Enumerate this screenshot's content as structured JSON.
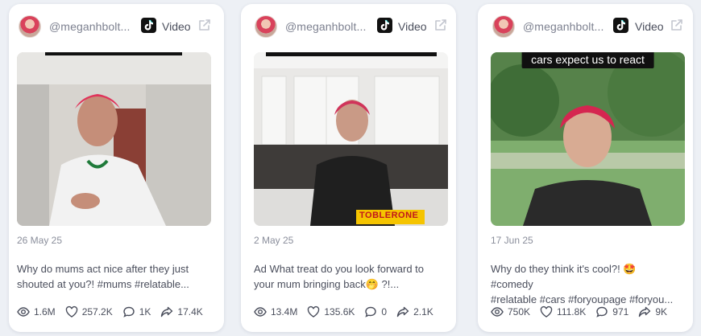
{
  "cards": [
    {
      "username": "@meganhbolt...",
      "source": "Video",
      "date": "26 May 25",
      "description_line1": "Why do mums act nice after they just",
      "description_line2": "shouted at you?! #mums #relatable...",
      "views": "1.6M",
      "likes": "257.2K",
      "comments": "1K",
      "shares": "17.4K"
    },
    {
      "username": "@meganhbolt...",
      "source": "Video",
      "date": "2 May 25",
      "description_line1": "Ad What treat do you look forward to",
      "description_line2": "your mum bringing back🤭 ?!...",
      "views": "13.4M",
      "likes": "135.6K",
      "comments": "0",
      "shares": "2.1K",
      "thumb_product_text": "TOBLERONE"
    },
    {
      "username": "@meganhbolt...",
      "source": "Video",
      "date": "17 Jun 25",
      "description_line1": "Why do they think it's cool?! 🤩 #comedy",
      "description_line2": "#relatable #cars #foryoupage #foryou...",
      "views": "750K",
      "likes": "111.8K",
      "comments": "971",
      "shares": "9K",
      "thumb_caption": "cars expect us to react"
    }
  ],
  "icons": {
    "platform": "tiktok-icon",
    "open": "external-link-icon",
    "views": "eye-icon",
    "likes": "heart-icon",
    "comments": "comment-icon",
    "shares": "share-icon"
  },
  "colors": {
    "background": "#edf0f5",
    "card": "#ffffff",
    "muted_text": "#7d8190",
    "body_text": "#4b4f5d"
  }
}
